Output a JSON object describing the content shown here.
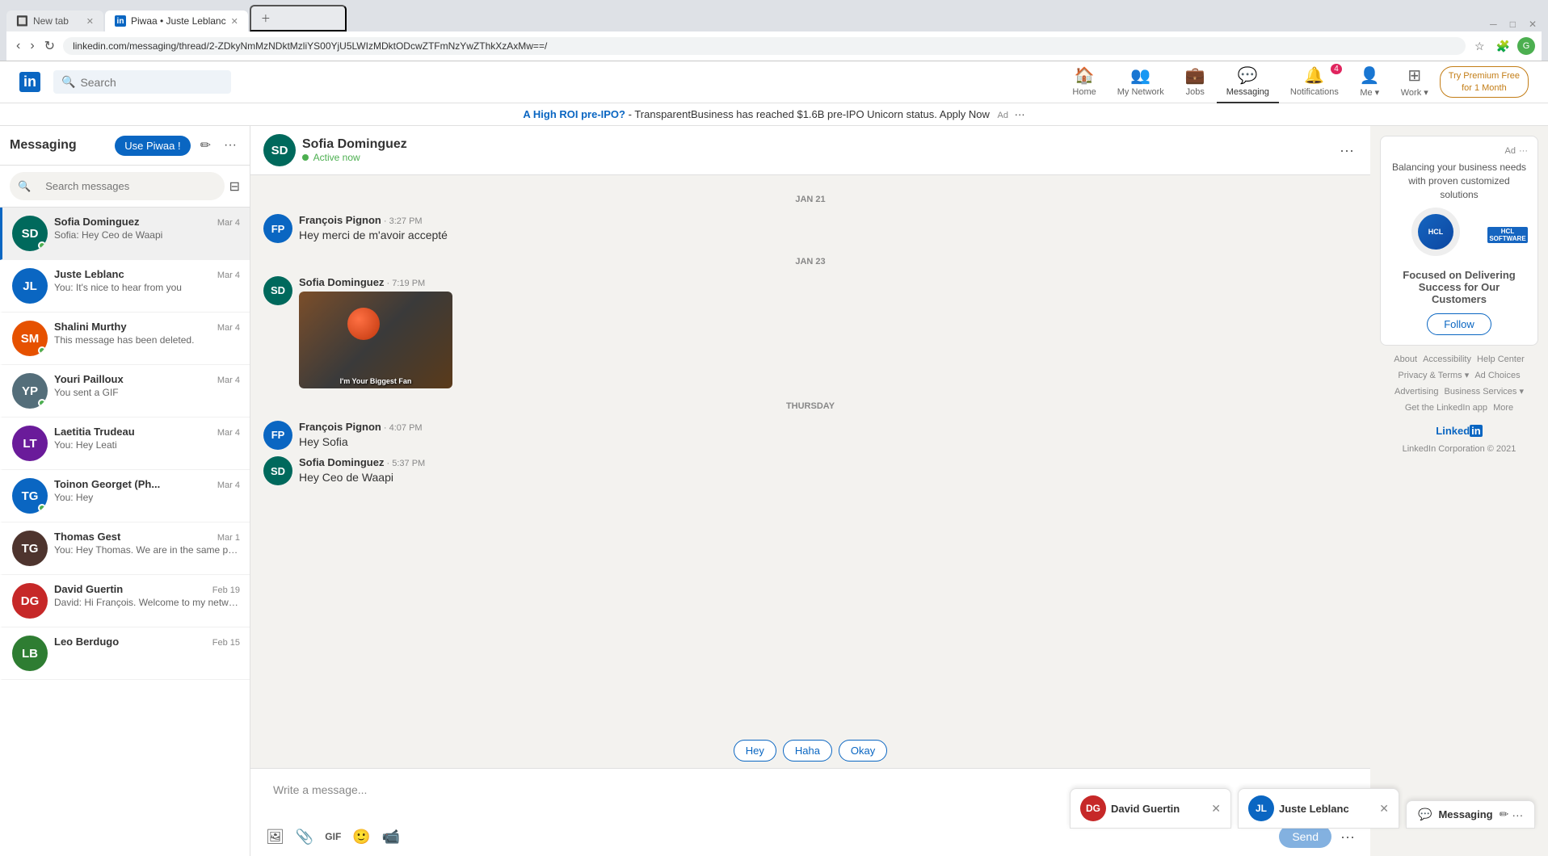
{
  "browser": {
    "tabs": [
      {
        "label": "New tab",
        "active": false,
        "favicon": "⬜"
      },
      {
        "label": "Piwaa • Juste Leblanc",
        "active": true,
        "favicon": "in"
      }
    ],
    "url": "linkedin.com/messaging/thread/2-ZDkyNmMzNDktMzliYS00YjU5LWIzMDktODcwZTFmNzYwZThkXzAxMw==/"
  },
  "header": {
    "logo": "in",
    "search_placeholder": "Search",
    "nav_items": [
      {
        "label": "Home",
        "icon": "🏠",
        "active": false
      },
      {
        "label": "My Network",
        "icon": "👥",
        "active": false
      },
      {
        "label": "Jobs",
        "icon": "💼",
        "active": false
      },
      {
        "label": "Messaging",
        "icon": "💬",
        "active": true
      },
      {
        "label": "Notifications",
        "icon": "🔔",
        "active": false,
        "badge": "4"
      },
      {
        "label": "Me",
        "icon": "👤",
        "active": false,
        "dropdown": true
      },
      {
        "label": "Work",
        "icon": "⊞",
        "active": false,
        "dropdown": true
      }
    ],
    "premium_cta": "Try Premium Free\nfor 1 Month"
  },
  "ad_banner": {
    "text_pre": "A High ROI pre-IPO?",
    "text_main": " - TransparentBusiness has reached $1.6B pre-IPO Unicorn status. Apply Now",
    "ad_label": "Ad",
    "more": "···"
  },
  "messaging_sidebar": {
    "title": "Messaging",
    "use_piwaa_label": "Use Piwaa !",
    "compose_icon": "✏",
    "more_icon": "···",
    "search_placeholder": "Search messages",
    "conversations": [
      {
        "name": "Sofia Dominguez",
        "date": "Mar 4",
        "preview": "Sofia: Hey Ceo de Waapi",
        "online": true,
        "active": true,
        "avatar_color": "av-teal",
        "initials": "SD"
      },
      {
        "name": "Juste Leblanc",
        "date": "Mar 4",
        "preview": "You: It's nice to hear from you",
        "online": false,
        "active": false,
        "avatar_color": "av-blue",
        "initials": "JL"
      },
      {
        "name": "Shalini Murthy",
        "date": "Mar 4",
        "preview": "This message has been deleted.",
        "online": true,
        "active": false,
        "avatar_color": "av-orange",
        "initials": "SM"
      },
      {
        "name": "Youri Pailloux",
        "date": "Mar 4",
        "preview": "You sent a GIF",
        "online": true,
        "active": false,
        "avatar_color": "av-gray",
        "initials": "YP"
      },
      {
        "name": "Laetitia Trudeau",
        "date": "Mar 4",
        "preview": "You: Hey Leati",
        "online": false,
        "active": false,
        "avatar_color": "av-purple",
        "initials": "LT"
      },
      {
        "name": "Toinon Georget (Ph...",
        "date": "Mar 4",
        "preview": "You: Hey",
        "online": true,
        "active": false,
        "avatar_color": "av-blue",
        "initials": "TG"
      },
      {
        "name": "Thomas Gest",
        "date": "Mar 1",
        "preview": "You: Hey Thomas. We are in the same pod. Let's connecti...",
        "online": false,
        "active": false,
        "avatar_color": "av-brown",
        "initials": "TG"
      },
      {
        "name": "David Guertin",
        "date": "Feb 19",
        "preview": "David: Hi François. Welcome to my network and the...",
        "online": false,
        "active": false,
        "avatar_color": "av-red",
        "initials": "DG"
      },
      {
        "name": "Leo Berdugo",
        "date": "Feb 15",
        "preview": "",
        "online": false,
        "active": false,
        "avatar_color": "av-green",
        "initials": "LB"
      }
    ]
  },
  "chat": {
    "contact_name": "Sofia Dominguez",
    "status": "Active now",
    "messages": [
      {
        "date_separator": "JAN 21",
        "sender": "François Pignon",
        "time": "3:27 PM",
        "text": "Hey merci de m'avoir accepté",
        "has_image": false,
        "initials": "FP",
        "avatar_color": "av-blue"
      },
      {
        "date_separator": "JAN 23",
        "sender": "Sofia Dominguez",
        "time": "7:19 PM",
        "text": "",
        "has_image": true,
        "gif_caption": "I'm Your Biggest Fan",
        "initials": "SD",
        "avatar_color": "av-teal"
      },
      {
        "date_separator": "THURSDAY",
        "sender": "François Pignon",
        "time": "4:07 PM",
        "text": "Hey Sofia",
        "has_image": false,
        "initials": "FP",
        "avatar_color": "av-blue"
      },
      {
        "date_separator": null,
        "sender": "Sofia Dominguez",
        "time": "5:37 PM",
        "text": "Hey Ceo de Waapi",
        "has_image": false,
        "initials": "SD",
        "avatar_color": "av-teal"
      }
    ],
    "quick_replies": [
      "Hey",
      "Haha",
      "Okay"
    ],
    "input_placeholder": "Write a message...",
    "send_label": "Send"
  },
  "right_sidebar": {
    "ad_label": "Ad",
    "ad_more": "···",
    "company_desc": "Balancing your business needs with proven customized solutions",
    "company_name": "HCL SOFTWARE",
    "ad_cta": "Focused on Delivering Success for Our Customers",
    "follow_label": "Follow",
    "footer": {
      "links": [
        "About",
        "Accessibility",
        "Help Center",
        "Privacy & Terms",
        "Ad Choices",
        "Advertising",
        "Business Services",
        "Get the LinkedIn app",
        "More"
      ],
      "copyright": "LinkedIn Corporation © 2021"
    }
  },
  "floating_chats": [
    {
      "name": "David Guertin",
      "initials": "DG",
      "avatar_color": "av-red"
    },
    {
      "name": "Juste Leblanc",
      "initials": "JL",
      "avatar_color": "av-blue"
    },
    {
      "name": "Messaging",
      "is_messaging": true
    }
  ]
}
